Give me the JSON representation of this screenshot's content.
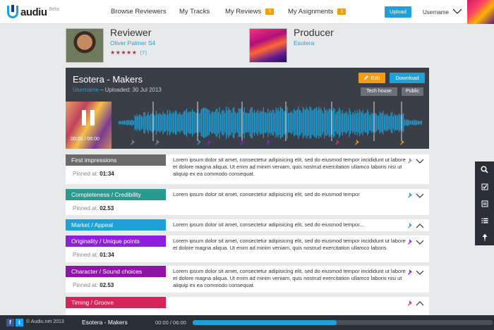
{
  "brand": {
    "name": "audiu",
    "beta": "Beta",
    "accent": "#1ea0d8"
  },
  "nav": {
    "items": [
      {
        "label": "Browse Reviewers"
      },
      {
        "label": "My Tracks"
      },
      {
        "label": "My Reviews",
        "badge": "3"
      },
      {
        "label": "My Asignments",
        "badge": "1"
      }
    ],
    "upload_label": "Upload",
    "username": "Username"
  },
  "reviewer": {
    "role": "Reviewer",
    "name": "Oliver Palmer S4",
    "stars": "★★★★★",
    "rating_count": "(7)"
  },
  "producer": {
    "role": "Producer",
    "name": "Esotera"
  },
  "track": {
    "title": "Esotera - Makers",
    "uploader": "Username",
    "uploaded": " – Uploaded: 30 Jul 2013",
    "edit_label": "Edit",
    "download_label": "Download",
    "tags": [
      "Tech house",
      "Public"
    ],
    "time": "00:00 / 06:00",
    "pin_colors": [
      "#888888",
      "#888888",
      "#1ea0d8",
      "#8e1fe0",
      "#8e1fe0",
      "#8e1fe0",
      "#d63a5a",
      "#f39c12",
      "#f39c12"
    ]
  },
  "feedback": [
    {
      "category": "First impressions",
      "color": "#6b6b6b",
      "pinned_label": "Pinned at:",
      "time": "01:34",
      "text": "Lorem ipsum dolor sit amet, consectetur adipisicing elit, sed do eiusmod tempor incididunt ut labore et dolore magna aliqua. Ut enim ad minim veniam, quis nostrud exercitation ullamco laboris nisi ut aliquip ex ea commodo consequat."
    },
    {
      "category": "Completeness / Credibility",
      "color": "#2a9a8f",
      "pinned_label": "Pinned at:",
      "time": "02.53",
      "text": "Lorem ipsum dolor sit amet, consectetur adipisicing elit, sed do eiusmod tempor"
    },
    {
      "category": "Market / Appeal",
      "color": "#1ea0d8",
      "text": "Lorem ipsum dolor sit amet, consectetur adipisicing elit, sed do eiusmod tempor..."
    },
    {
      "category": "Originality / Unique points",
      "color": "#8e1fe0",
      "pinned_label": "Pinned at:",
      "time": "01:34",
      "text": "Lorem ipsum dolor sit amet, consectetur adipisicing elit, sed do eiusmod tempor incididunt ut labore et dolore magna aliqua. Ut enim ad minim veniam, quis nostrud exercitation ullamco laboris"
    },
    {
      "category": "Character / Sound choices",
      "color": "#9012a8",
      "pinned_label": "Pinned at:",
      "time": "02.53",
      "text": "Lorem ipsum dolor sit amet, consectetur adipisicing elit, sed do eiusmod tempor incididunt ut labore et dolore magna aliqua. Ut enim ad minim veniam, quis nostrud exercitation ullamco laboris nisi ut aliquip ex ea commodo consequat."
    },
    {
      "category": "Timing / Groove",
      "color": "#d6245a"
    }
  ],
  "sidebar": {
    "icons": [
      "search-icon",
      "checkbox-icon",
      "notes-icon",
      "list-icon",
      "pin-icon"
    ]
  },
  "footer": {
    "social": [
      "f",
      "t"
    ],
    "copyright": "© Audiu.net 2013",
    "track": "Esotera - Makers",
    "time": "00:00 / 06:00",
    "progress": 0.48
  }
}
